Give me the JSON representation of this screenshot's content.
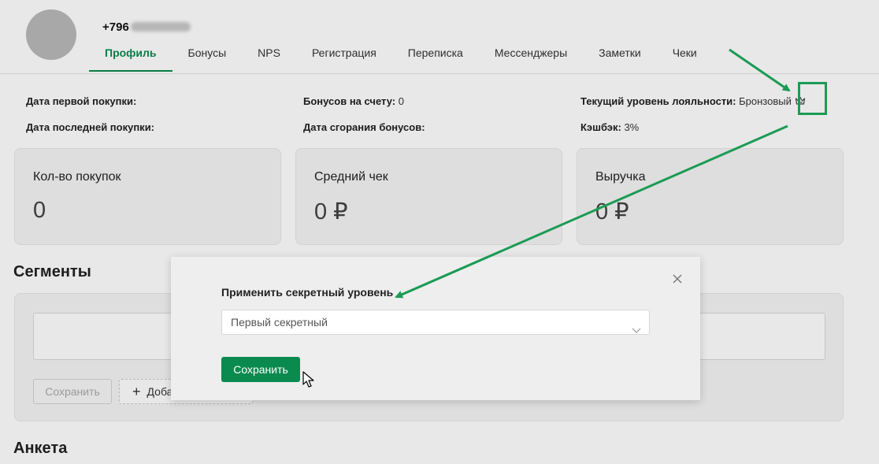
{
  "header": {
    "phone_prefix": "+796",
    "tabs": [
      {
        "label": "Профиль"
      },
      {
        "label": "Бонусы"
      },
      {
        "label": "NPS"
      },
      {
        "label": "Регистрация"
      },
      {
        "label": "Переписка"
      },
      {
        "label": "Мессенджеры"
      },
      {
        "label": "Заметки"
      },
      {
        "label": "Чеки"
      }
    ],
    "active_tab": "Профиль"
  },
  "info": {
    "first_purchase_label": "Дата первой покупки:",
    "last_purchase_label": "Дата последней покупки:",
    "bonus_balance_label": "Бонусов на счету:",
    "bonus_balance_value": "0",
    "bonus_expiry_label": "Дата сгорания бонусов:",
    "loyalty_label": "Текущий уровень лояльности:",
    "loyalty_value": "Бронзовый",
    "cashback_label": "Кэшбэк:",
    "cashback_value": "3%"
  },
  "cards": [
    {
      "label": "Кол-во покупок",
      "value": "0"
    },
    {
      "label": "Средний чек",
      "value": "0 ₽"
    },
    {
      "label": "Выручка",
      "value": "0 ₽"
    }
  ],
  "segments": {
    "title": "Сегменты",
    "save_label": "Сохранить",
    "add_label": "Добавить"
  },
  "questionnaire": {
    "title": "Анкета"
  },
  "modal": {
    "title": "Применить секретный уровень",
    "select_value": "Первый секретный",
    "save_label": "Сохранить"
  },
  "icons": {
    "loyalty": "crown-icon",
    "close": "close-icon",
    "select": "chevron-down-icon",
    "pointer": "cursor-icon"
  },
  "colors": {
    "accent": "#0b8a4f",
    "annotation": "#1b9b55"
  }
}
